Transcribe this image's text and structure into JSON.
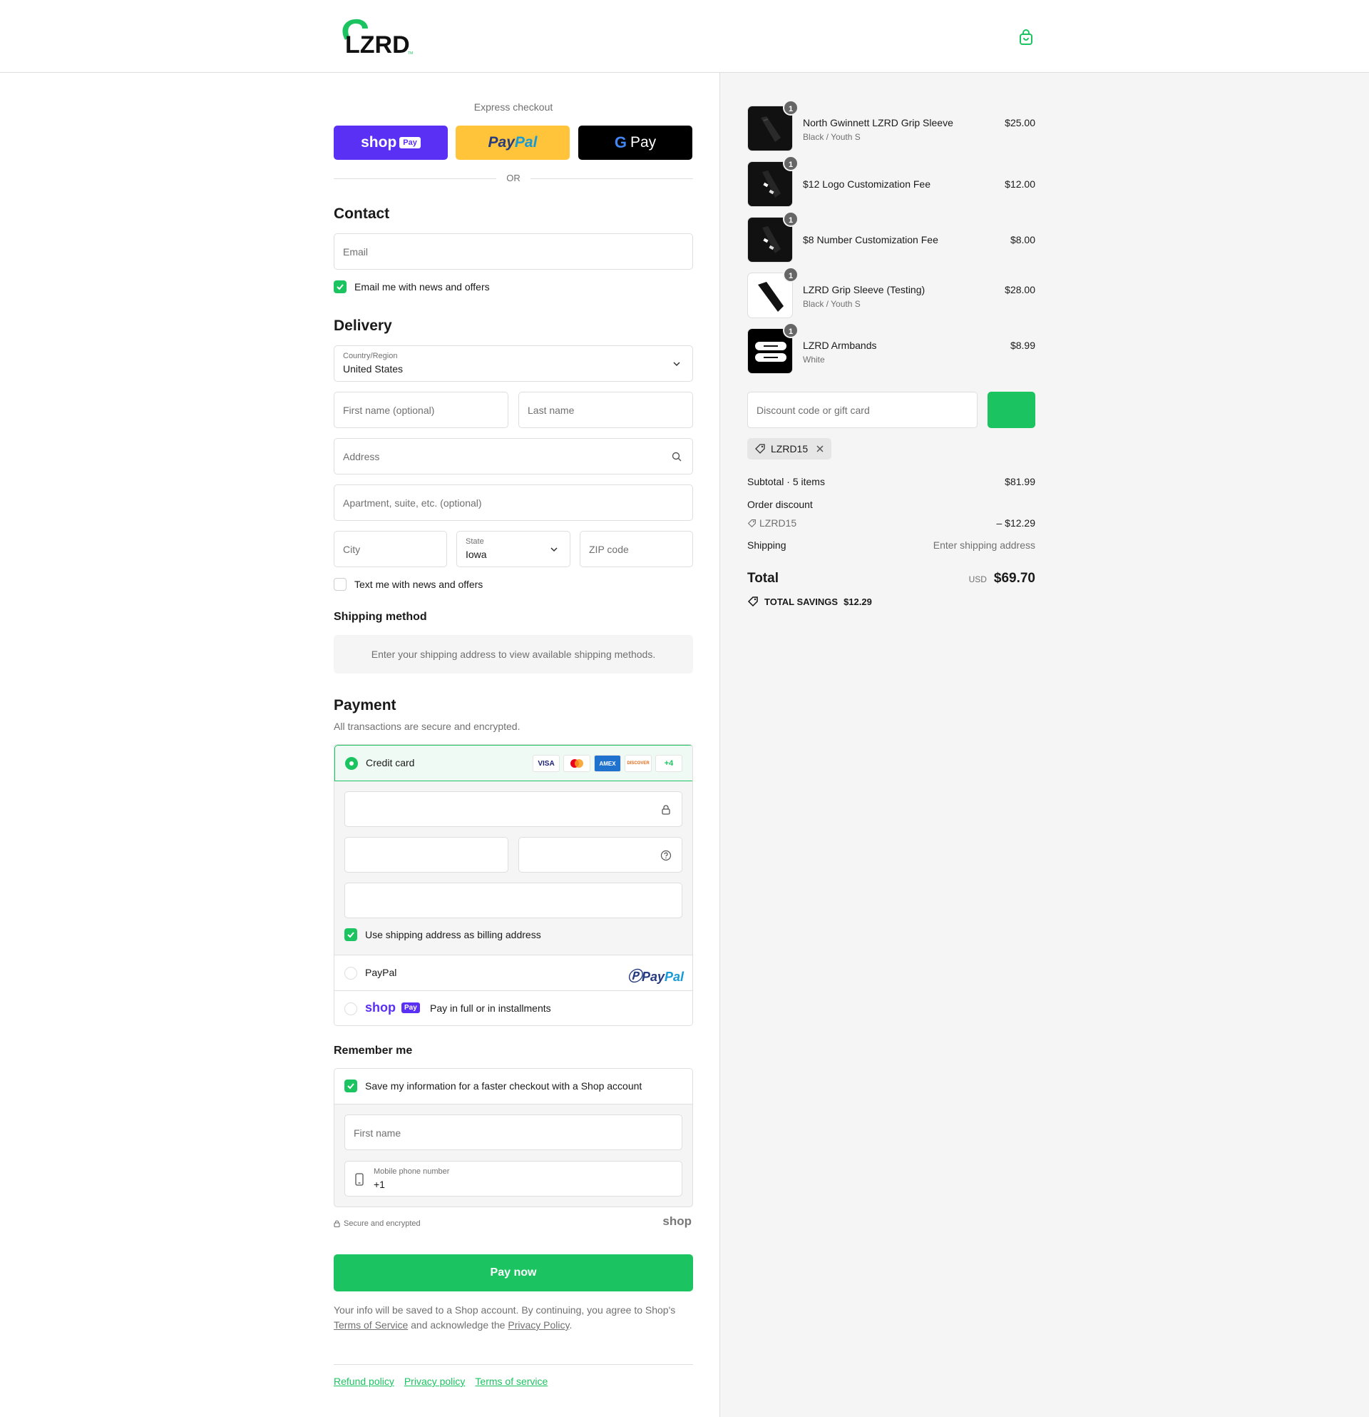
{
  "header": {
    "brand": "LZRD",
    "trademark": "TM"
  },
  "express": {
    "title": "Express checkout",
    "or": "OR",
    "shop_text": "shop",
    "shop_pay": "Pay",
    "paypal_pay": "Pay",
    "paypal_pal": "Pal",
    "gpay_g": "G",
    "gpay_pay": "Pay"
  },
  "contact": {
    "title": "Contact",
    "email_placeholder": "Email",
    "news_label": "Email me with news and offers"
  },
  "delivery": {
    "title": "Delivery",
    "country_label": "Country/Region",
    "country_value": "United States",
    "first_name": "First name (optional)",
    "last_name": "Last name",
    "address": "Address",
    "apartment": "Apartment, suite, etc. (optional)",
    "city": "City",
    "state_label": "State",
    "state_value": "Iowa",
    "zip": "ZIP code",
    "text_label": "Text me with news and offers"
  },
  "shipping_method": {
    "title": "Shipping method",
    "message": "Enter your shipping address to view available shipping methods."
  },
  "payment": {
    "title": "Payment",
    "subtitle": "All transactions are secure and encrypted.",
    "credit_card": "Credit card",
    "card_brands": [
      "VISA",
      "",
      "AMEX",
      "DISCOVER"
    ],
    "more_cards": "+4",
    "billing_label": "Use shipping address as billing address",
    "paypal_label": "PayPal",
    "paypal_logo_pay": "Pay",
    "paypal_logo_pal": "Pal",
    "shop_logo": "shop",
    "shop_badge": "Pay",
    "shop_label": "Pay in full or in installments"
  },
  "remember": {
    "title": "Remember me",
    "save_label": "Save my information for a faster checkout with a Shop account",
    "first_name": "First name",
    "phone_label": "Mobile phone number",
    "phone_value": "+1",
    "secure": "Secure and encrypted",
    "shop_mark": "shop"
  },
  "pay_now": "Pay now",
  "legal": {
    "before": "Your info will be saved to a Shop account. By continuing, you agree to Shop's ",
    "terms": "Terms of Service",
    "middle": " and acknowledge the ",
    "privacy": "Privacy Policy",
    "after": "."
  },
  "footer": {
    "refund": "Refund policy",
    "privacy": "Privacy policy",
    "terms": "Terms of service"
  },
  "cart": {
    "items": [
      {
        "qty": "1",
        "name": "North Gwinnett LZRD Grip Sleeve",
        "variant": "Black / Youth S",
        "price": "$25.00"
      },
      {
        "qty": "1",
        "name": "$12 Logo Customization Fee",
        "variant": "",
        "price": "$12.00"
      },
      {
        "qty": "1",
        "name": "$8 Number Customization Fee",
        "variant": "",
        "price": "$8.00"
      },
      {
        "qty": "1",
        "name": "LZRD Grip Sleeve (Testing)",
        "variant": "Black / Youth S",
        "price": "$28.00"
      },
      {
        "qty": "1",
        "name": "LZRD Armbands",
        "variant": "White",
        "price": "$8.99"
      }
    ],
    "discount_placeholder": "Discount code or gift card",
    "applied_code": "LZRD15",
    "subtotal_label": "Subtotal · 5 items",
    "subtotal": "$81.99",
    "order_discount_label": "Order discount",
    "discount_code": "LZRD15",
    "discount_value": "– $12.29",
    "shipping_label": "Shipping",
    "shipping_value": "Enter shipping address",
    "total_label": "Total",
    "currency": "USD",
    "total": "$69.70",
    "savings_label": "TOTAL SAVINGS",
    "savings_value": "$12.29"
  },
  "colors": {
    "accent": "#1bc460",
    "shop_purple": "#5a31f4",
    "paypal_yellow": "#ffc439"
  }
}
